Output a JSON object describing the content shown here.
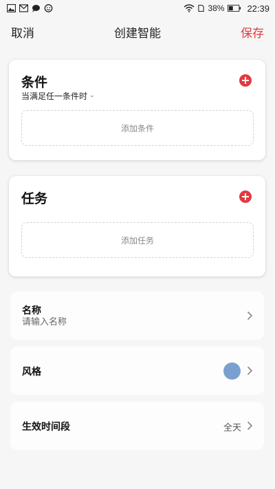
{
  "status_bar": {
    "battery": "38%",
    "time": "22:39"
  },
  "header": {
    "cancel_label": "取消",
    "title": "创建智能",
    "save_label": "保存"
  },
  "conditions": {
    "title": "条件",
    "match_mode": "当满足任一条件时",
    "add_label": "添加条件"
  },
  "tasks": {
    "title": "任务",
    "add_label": "添加任务"
  },
  "name_row": {
    "label": "名称",
    "placeholder": "请输入名称"
  },
  "style_row": {
    "label": "风格",
    "color": "#7aa0cf"
  },
  "time_row": {
    "label": "生效时间段",
    "value": "全天"
  },
  "colors": {
    "accent": "#e5393f",
    "background": "#f6f6f6"
  },
  "icons": {
    "add": "plus-circle-icon",
    "chevron": "chevron-right-icon",
    "dropdown": "chevron-down-icon"
  }
}
